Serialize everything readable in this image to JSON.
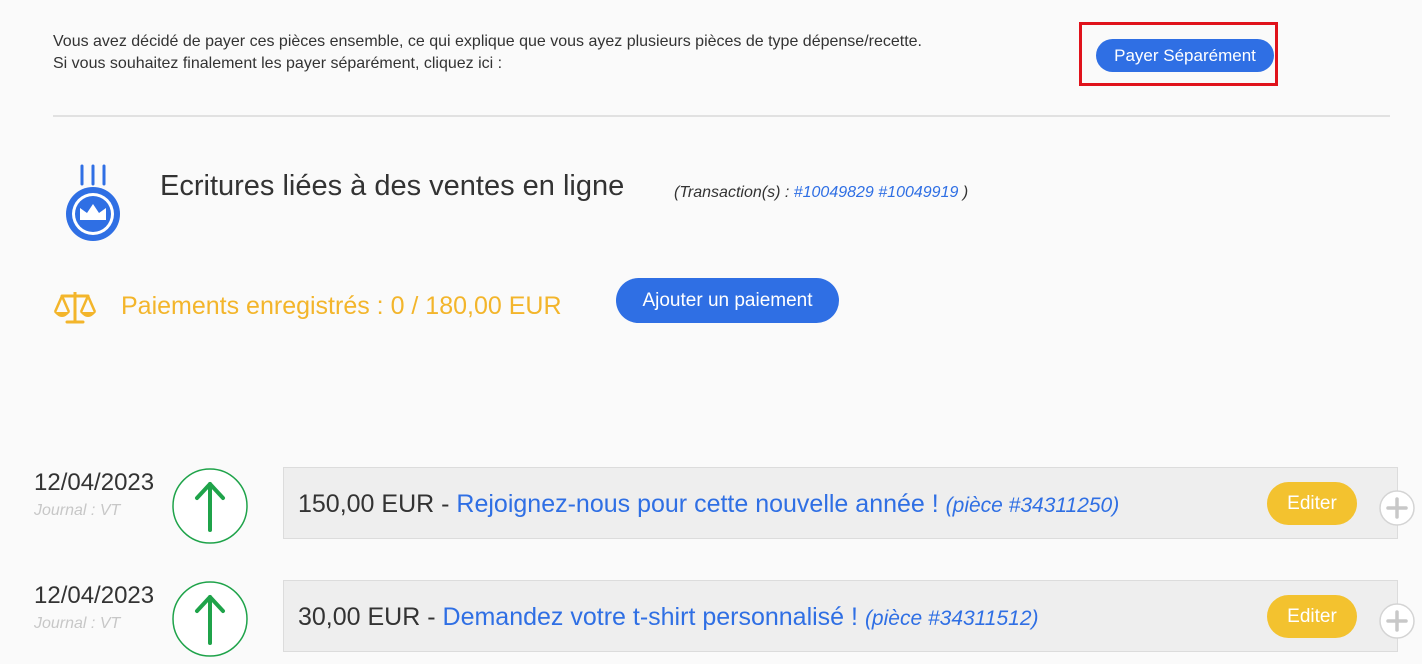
{
  "notice": {
    "line1": "Vous avez décidé de payer ces pièces ensemble, ce qui explique que vous ayez plusieurs pièces de type dépense/recette.",
    "line2": "Si vous souhaitez finalement les payer séparément, cliquez ici :",
    "button_label": "Payer Séparément"
  },
  "header": {
    "title": "Ecritures liées à des ventes en ligne",
    "transactions_prefix": "(Transaction(s) : ",
    "transaction_1": "#10049829",
    "transaction_2": "#10049919",
    "transactions_suffix": " )",
    "icon": "medal-crown-icon"
  },
  "payments": {
    "label": "Paiements enregistrés : 0 / 180,00 EUR",
    "add_button_label": "Ajouter un paiement",
    "icon": "scale-icon"
  },
  "entries": [
    {
      "date": "12/04/2023",
      "journal": "Journal : VT",
      "amount": "150,00 EUR",
      "separator": " - ",
      "title": "Rejoignez-nous pour cette nouvelle année !",
      "piece": "(pièce #34311250)",
      "edit_label": "Editer"
    },
    {
      "date": "12/04/2023",
      "journal": "Journal : VT",
      "amount": "30,00 EUR",
      "separator": " - ",
      "title": "Demandez votre t-shirt personnalisé !",
      "piece": "(pièce #34311512)",
      "edit_label": "Editer"
    }
  ],
  "colors": {
    "accent_blue": "#2f6fe4",
    "payments_yellow": "#f3b52b",
    "edit_yellow": "#f3c22f",
    "arrow_green": "#1fa34a",
    "highlight_red": "#e0121b"
  }
}
